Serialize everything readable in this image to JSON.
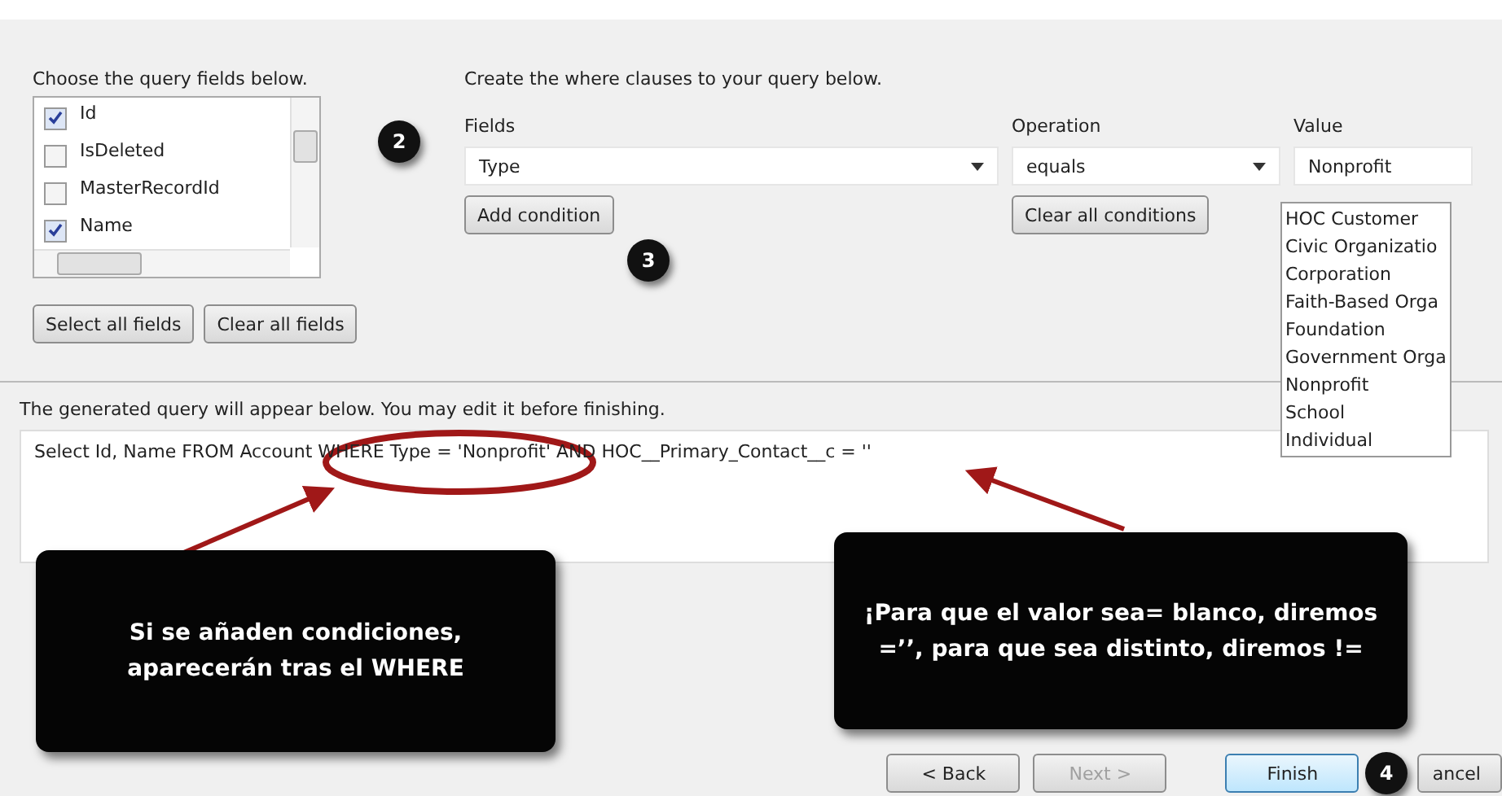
{
  "fields_panel": {
    "label": "Choose the query fields below.",
    "fields": [
      {
        "label": "Id",
        "checked": true
      },
      {
        "label": "IsDeleted",
        "checked": false
      },
      {
        "label": "MasterRecordId",
        "checked": false
      },
      {
        "label": "Name",
        "checked": true
      }
    ],
    "buttons": [
      "Select all fields",
      "Clear all fields"
    ]
  },
  "conditions": {
    "label": "Create the where clauses to your query below.",
    "fields_label": "Fields",
    "fields_value": "Type",
    "operation_label": "Operation",
    "operation_value": "equals",
    "value_label": "Value",
    "value_value": "Nonprofit",
    "add_button": "Add condition",
    "clear_button": "Clear all conditions",
    "value_options": [
      "HOC Customer",
      "Civic Organizatio",
      "Corporation",
      "Faith-Based Orga",
      "Foundation",
      "Government Orga",
      "Nonprofit",
      "School",
      "Individual"
    ]
  },
  "query": {
    "label": "The generated query will appear below.  You may edit it before finishing.",
    "text": "Select Id, Name FROM Account WHERE Type = 'Nonprofit' AND HOC__Primary_Contact__c = ''"
  },
  "buttons": [
    {
      "label": "< Back",
      "disabled": false,
      "default": false
    },
    {
      "label": "Next >",
      "disabled": true,
      "default": false
    },
    {
      "label": "Finish",
      "disabled": false,
      "default": true
    },
    {
      "label": "ancel",
      "disabled": false,
      "default": false
    }
  ],
  "annotations": {
    "markers": [
      "2",
      "3",
      "4"
    ],
    "callouts": [
      "Si se añaden condiciones, aparecerán tras el WHERE",
      "¡Para que el valor sea= blanco, diremos =’’, para que sea distinto, diremos !="
    ]
  }
}
